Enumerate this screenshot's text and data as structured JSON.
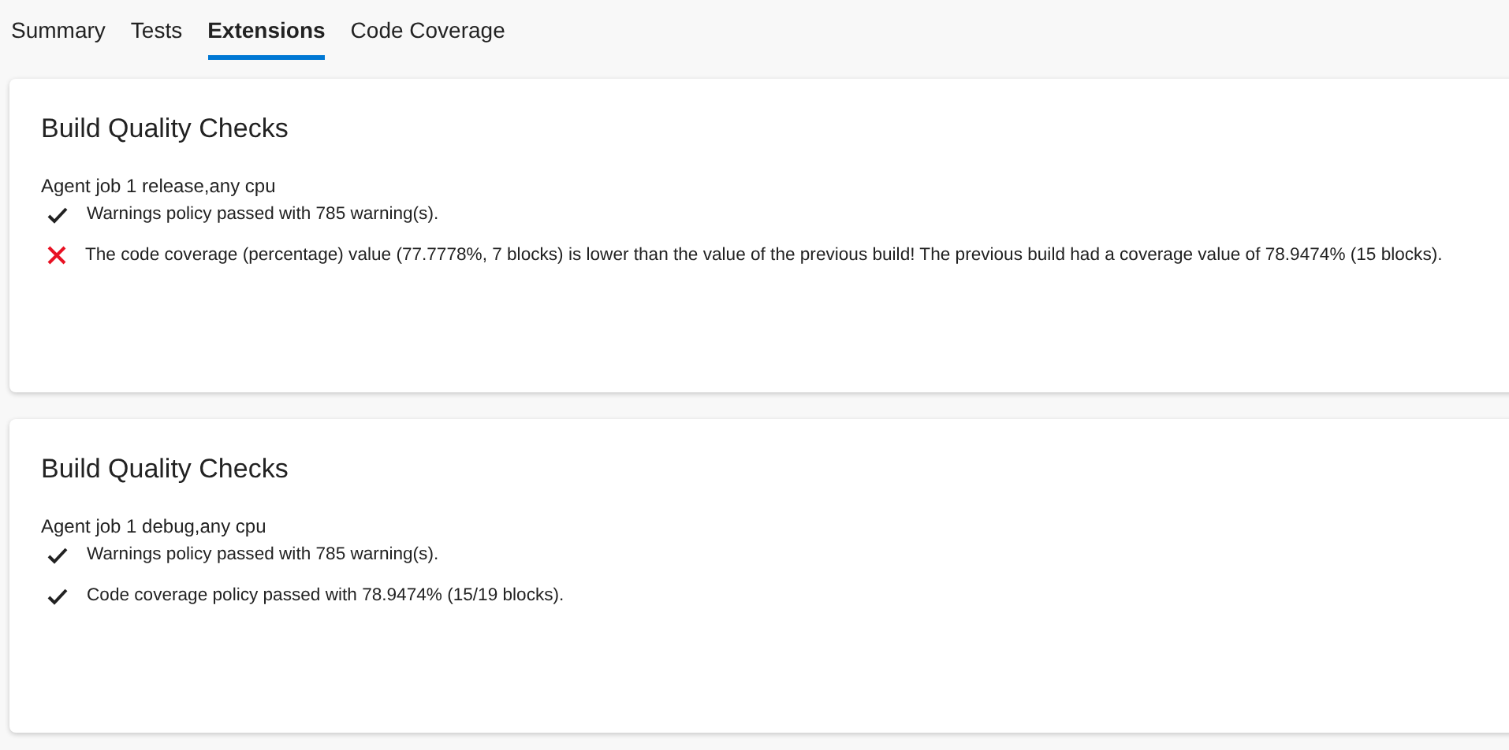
{
  "tabs": [
    {
      "label": "Summary",
      "selected": false
    },
    {
      "label": "Tests",
      "selected": false
    },
    {
      "label": "Extensions",
      "selected": true
    },
    {
      "label": "Code Coverage",
      "selected": false
    }
  ],
  "cards": [
    {
      "title": "Build Quality Checks",
      "job": "Agent job 1 release,any cpu",
      "checks": [
        {
          "passed": true,
          "text": "Warnings policy passed with 785 warning(s)."
        },
        {
          "passed": false,
          "text": "The code coverage (percentage) value (77.7778%, 7 blocks) is lower than the value of the previous build! The previous build had a coverage value of 78.9474% (15 blocks)."
        }
      ]
    },
    {
      "title": "Build Quality Checks",
      "job": "Agent job 1 debug,any cpu",
      "checks": [
        {
          "passed": true,
          "text": "Warnings policy passed with 785 warning(s)."
        },
        {
          "passed": true,
          "text": "Code coverage policy passed with 78.9474% (15/19 blocks)."
        }
      ]
    }
  ]
}
